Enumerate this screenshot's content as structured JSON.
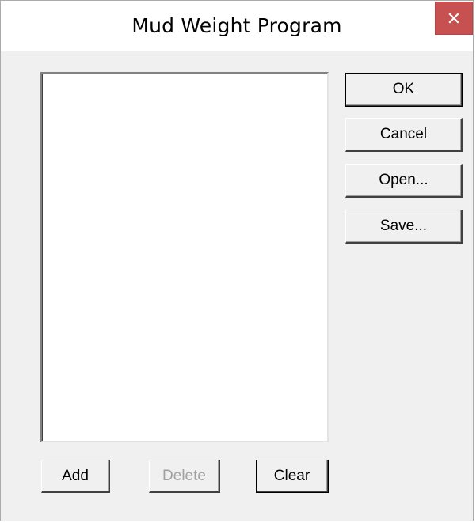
{
  "window": {
    "title": "Mud Weight Program",
    "close_icon": "close-icon"
  },
  "listbox": {
    "items": []
  },
  "buttons": {
    "ok": "OK",
    "cancel": "Cancel",
    "open": "Open...",
    "save": "Save...",
    "add": "Add",
    "delete": "Delete",
    "clear": "Clear"
  },
  "colors": {
    "close_button": "#c75050",
    "dialog_background": "#f0f0f0",
    "disabled_text": "#a0a0a0"
  }
}
